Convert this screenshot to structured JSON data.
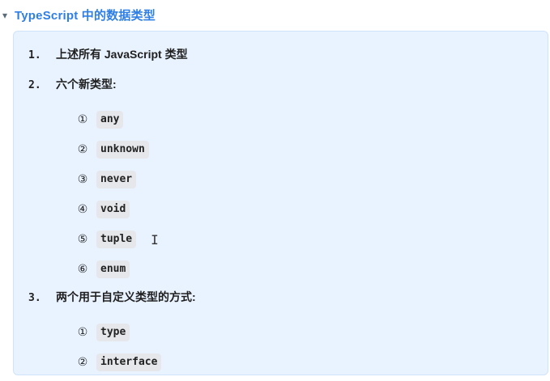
{
  "header": {
    "title": "TypeScript 中的数据类型",
    "icon": "chevron-down-icon"
  },
  "content": {
    "items": [
      {
        "num": "1.",
        "text": "上述所有 JavaScript 类型"
      },
      {
        "num": "2.",
        "text": "六个新类型:"
      },
      {
        "num": "3.",
        "text": "两个用于自定义类型的方式:"
      }
    ],
    "new_types": [
      {
        "mark": "①",
        "code": "any"
      },
      {
        "mark": "②",
        "code": "unknown"
      },
      {
        "mark": "③",
        "code": "never"
      },
      {
        "mark": "④",
        "code": "void"
      },
      {
        "mark": "⑤",
        "code": "tuple"
      },
      {
        "mark": "⑥",
        "code": "enum"
      }
    ],
    "custom_ways": [
      {
        "mark": "①",
        "code": "type"
      },
      {
        "mark": "②",
        "code": "interface"
      }
    ],
    "cursor_glyph": "I"
  },
  "colors": {
    "title": "#2f7fe6",
    "panel_bg": "#e9f3ff",
    "panel_border": "#cfe3fb",
    "code_bg": "#e5e7eb"
  }
}
